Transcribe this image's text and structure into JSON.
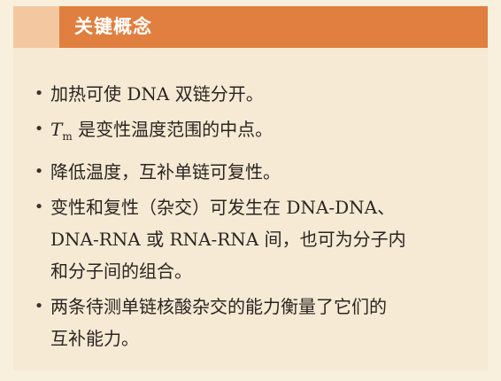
{
  "header": {
    "title": "关键概念"
  },
  "items": [
    {
      "text": "加热可使 DNA 双链分开。"
    },
    {
      "symbol": "T",
      "subscript": "m",
      "text": " 是变性温度范围的中点。"
    },
    {
      "text": "降低温度，互补单链可复性。"
    },
    {
      "lines": [
        "变性和复性（杂交）可发生在 DNA-DNA、",
        "DNA-RNA 或 RNA-RNA 间，也可为分子内",
        "和分子间的组合。"
      ]
    },
    {
      "lines": [
        "两条待测单链核酸杂交的能力衡量了它们的",
        "互补能力。"
      ]
    }
  ],
  "colors": {
    "banner": "#e07f3f",
    "banner_tab": "#f3c8a0",
    "background": "#f6ead5"
  }
}
